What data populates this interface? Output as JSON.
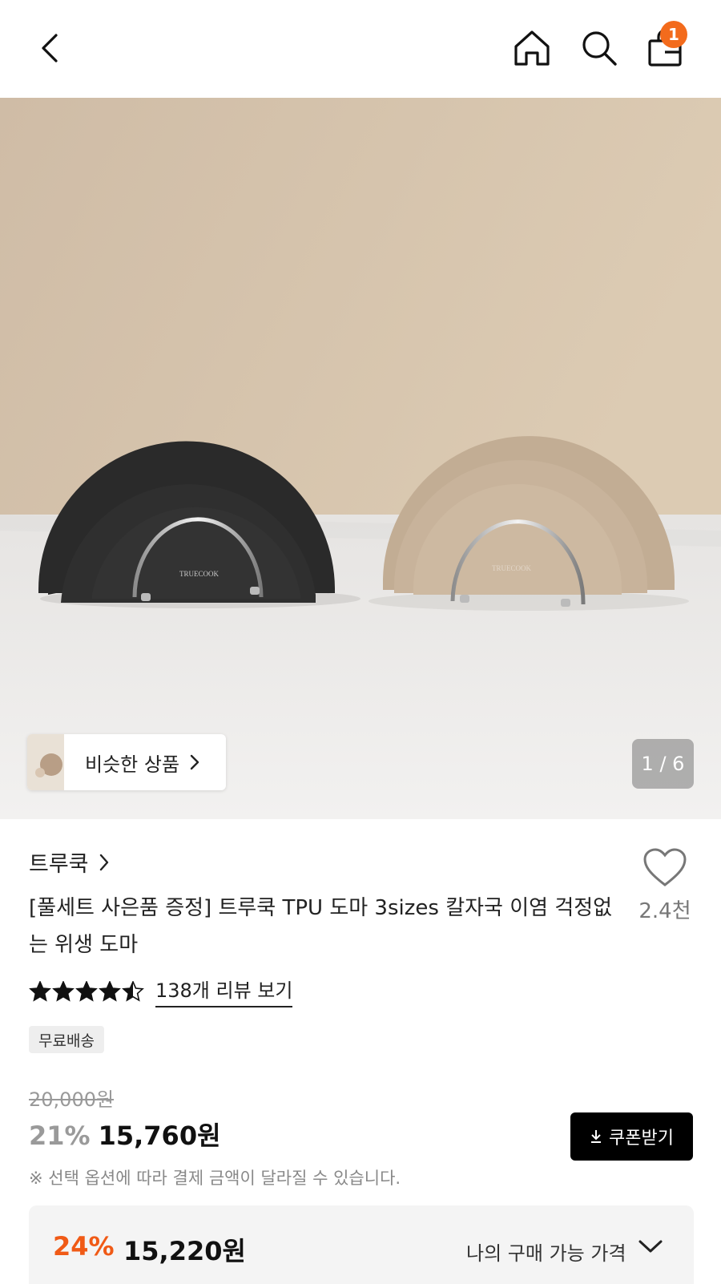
{
  "header": {
    "cart_badge": "1"
  },
  "hero": {
    "similar_label": "비슷한 상품",
    "counter": "1 / 6",
    "stamp_dark": "TRUECOOK",
    "stamp_light": "TRUECOOK"
  },
  "product": {
    "brand": "트루쿡",
    "title": "[풀세트 사은품 증정] 트루쿡 TPU 도마 3sizes 칼자국 이염 걱정없는 위생 도마",
    "wish_count": "2.4천",
    "rating": 4.5,
    "review_link": "138개 리뷰 보기",
    "badge": "무료배송"
  },
  "price": {
    "original": "20,000원",
    "discount": "21%",
    "sale": "15,760원",
    "coupon_label": "쿠폰받기",
    "notice": "※ 선택 옵션에 따라 결제 금액이 달라질 수 있습니다."
  },
  "my_price": {
    "discount": "24%",
    "price": "15,220원",
    "label": "나의 구매 가능 가격"
  },
  "colors": {
    "accent": "#f36b1c",
    "my_discount": "#f05a16",
    "board_dark": "#2b2b2b",
    "board_beige": "#c9b49b"
  }
}
